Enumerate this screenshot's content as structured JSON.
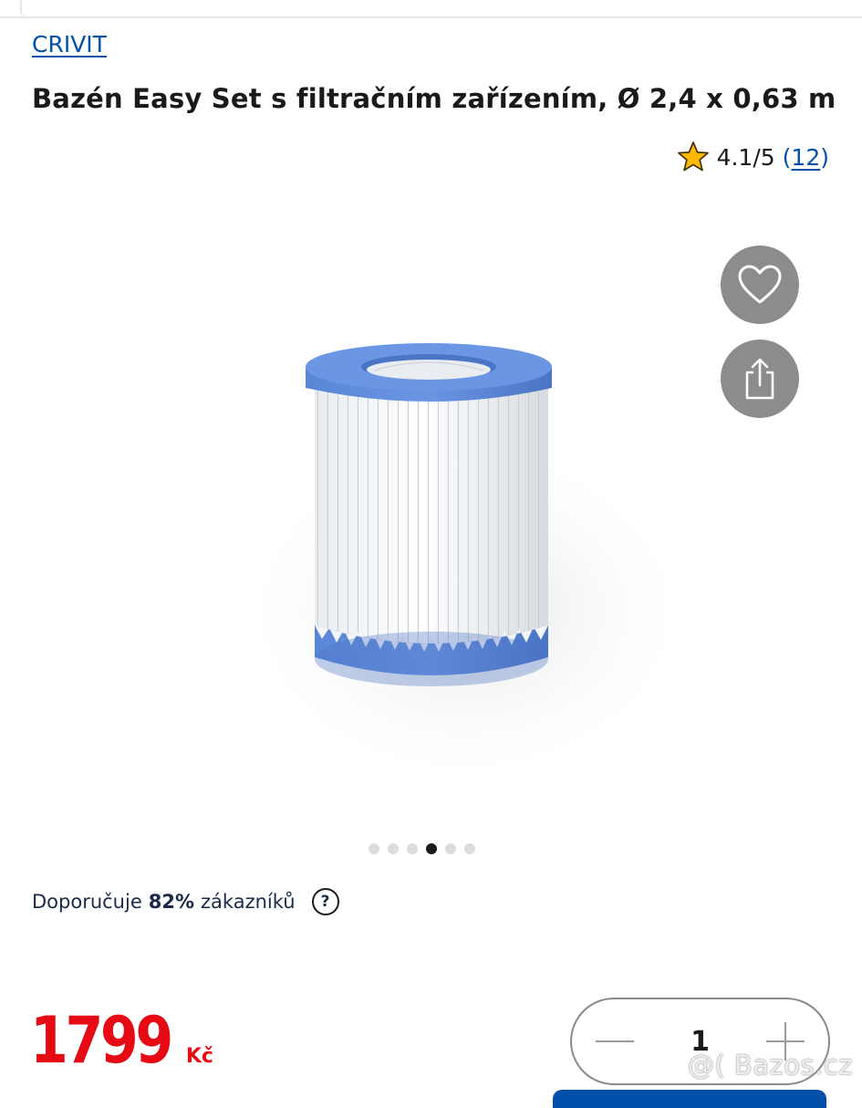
{
  "header": {
    "brand": "CRIVIT",
    "title": "Bazén Easy Set s filtračním zařízením, Ø 2,4 x 0,63 m"
  },
  "rating": {
    "icon": "star-icon",
    "value": "4.1/5",
    "open_paren": "(",
    "count": "12",
    "close_paren": ")"
  },
  "actions": {
    "favorite_icon": "heart-icon",
    "share_icon": "share-icon"
  },
  "gallery": {
    "total_images": 6,
    "active_index": 3
  },
  "recommendation": {
    "prefix": "Doporučuje",
    "percent": "82%",
    "suffix": "zákazníků",
    "help_symbol": "?"
  },
  "price": {
    "amount": "1799",
    "currency": "Kč"
  },
  "quantity": {
    "value": "1"
  },
  "watermark": "@( Bazos.cz",
  "colors": {
    "brand_blue": "#0050aa",
    "price_red": "#e60a14",
    "filter_blue": "#5b86d6",
    "button_gray": "#8c8c8c"
  }
}
